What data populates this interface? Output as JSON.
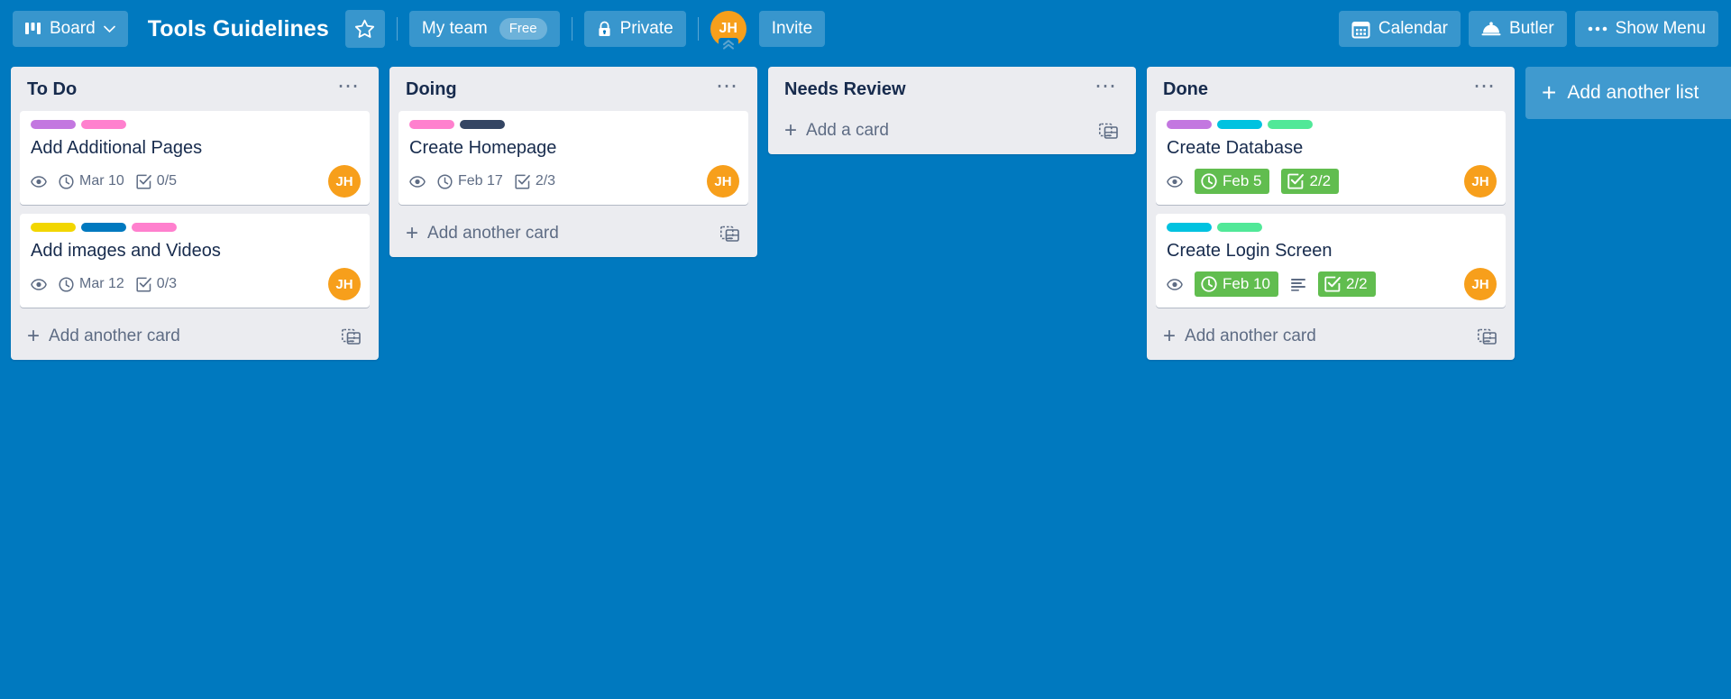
{
  "header": {
    "board_switch_label": "Board",
    "board_title": "Tools Guidelines",
    "team_label": "My team",
    "plan_badge": "Free",
    "visibility_label": "Private",
    "avatar_initials": "JH",
    "invite_label": "Invite",
    "calendar_label": "Calendar",
    "butler_label": "Butler",
    "show_menu_label": "Show Menu",
    "background_color": "#0079bf"
  },
  "board": {
    "add_list_label": "Add another list",
    "lists": [
      {
        "title": "To Do",
        "footer_label": "Add another card",
        "cards": [
          {
            "title": "Add Additional Pages",
            "labels": [
              "#c377e0",
              "#ff80ce"
            ],
            "watching": true,
            "due": "Mar 10",
            "due_complete": false,
            "has_description": false,
            "checklist": "0/5",
            "checklist_complete": false,
            "member_initials": "JH"
          },
          {
            "title": "Add images and Videos",
            "labels": [
              "#f2d600",
              "#0079bf",
              "#ff80ce"
            ],
            "watching": true,
            "due": "Mar 12",
            "due_complete": false,
            "has_description": false,
            "checklist": "0/3",
            "checklist_complete": false,
            "member_initials": "JH"
          }
        ]
      },
      {
        "title": "Doing",
        "footer_label": "Add another card",
        "cards": [
          {
            "title": "Create Homepage",
            "labels": [
              "#ff80ce",
              "#344563"
            ],
            "watching": true,
            "due": "Feb 17",
            "due_complete": false,
            "has_description": false,
            "checklist": "2/3",
            "checklist_complete": false,
            "member_initials": "JH"
          }
        ]
      },
      {
        "title": "Needs Review",
        "footer_label": "Add a card",
        "cards": []
      },
      {
        "title": "Done",
        "footer_label": "Add another card",
        "cards": [
          {
            "title": "Create Database",
            "labels": [
              "#c377e0",
              "#00c2e0",
              "#51e898"
            ],
            "watching": true,
            "due": "Feb 5",
            "due_complete": true,
            "has_description": false,
            "checklist": "2/2",
            "checklist_complete": true,
            "member_initials": "JH"
          },
          {
            "title": "Create Login Screen",
            "labels": [
              "#00c2e0",
              "#51e898"
            ],
            "watching": true,
            "due": "Feb 10",
            "due_complete": true,
            "has_description": true,
            "checklist": "2/2",
            "checklist_complete": true,
            "member_initials": "JH"
          }
        ]
      }
    ]
  },
  "colors": {
    "board_background": "#0079bf",
    "list_background": "#ebecf0",
    "card_background": "#ffffff",
    "due_complete_green": "#61bd4f",
    "avatar_orange": "#f79f1b",
    "text_dark": "#172b4d",
    "text_muted": "#5e6c84"
  }
}
